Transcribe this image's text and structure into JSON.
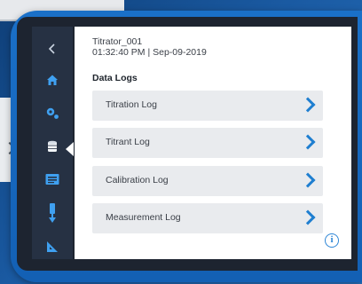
{
  "header": {
    "device_name": "Titrator_001",
    "datetime": "01:32:40 PM | Sep-09-2019"
  },
  "section_title": "Data Logs",
  "logs": [
    {
      "label": "Titration Log"
    },
    {
      "label": "Titrant Log"
    },
    {
      "label": "Calibration Log"
    },
    {
      "label": "Measurement Log"
    }
  ],
  "nav": [
    "back-icon",
    "home-icon",
    "settings-icon",
    "database-icon",
    "report-icon",
    "electrode-icon",
    "titration-icon"
  ],
  "info_glyph": "i",
  "colors": {
    "accent": "#1f7fd0",
    "device_blue": "#1a6bc0",
    "sidebar": "#263143",
    "button_bg": "#e9ebee"
  }
}
